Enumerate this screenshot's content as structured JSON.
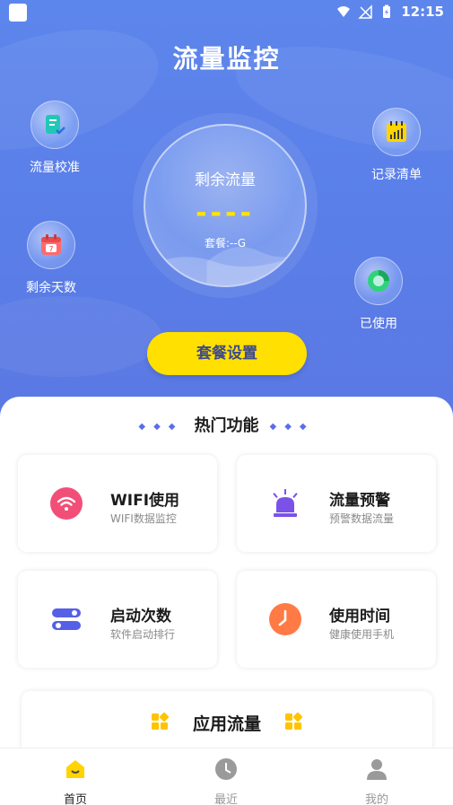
{
  "status": {
    "time": "12:15"
  },
  "header": {
    "title": "流量监控"
  },
  "features": {
    "calibrate": "流量校准",
    "days_left": "剩余天数",
    "records": "记录清单",
    "used": "已使用"
  },
  "orb": {
    "title": "剩余流量",
    "value": "----",
    "plan": "套餐:--G"
  },
  "plan_button": "套餐设置",
  "hot": {
    "title": "热门功能",
    "cards": [
      {
        "title": "WIFI使用",
        "sub": "WIFI数据监控",
        "icon": "wifi-icon"
      },
      {
        "title": "流量预警",
        "sub": "预警数据流量",
        "icon": "alarm-icon"
      },
      {
        "title": "启动次数",
        "sub": "软件启动排行",
        "icon": "toggle-icon"
      },
      {
        "title": "使用时间",
        "sub": "健康使用手机",
        "icon": "clock-icon"
      }
    ]
  },
  "app_flow": {
    "title": "应用流量"
  },
  "tabs": [
    {
      "label": "首页",
      "icon": "home-icon"
    },
    {
      "label": "最近",
      "icon": "clock-icon"
    },
    {
      "label": "我的",
      "icon": "user-icon"
    }
  ],
  "colors": {
    "hero": "#5d86ec",
    "accent": "#ffe000",
    "wifi": "#f24f78",
    "alarm": "#7b52e8",
    "toggle": "#5560e6",
    "clock": "#ff7a45"
  }
}
